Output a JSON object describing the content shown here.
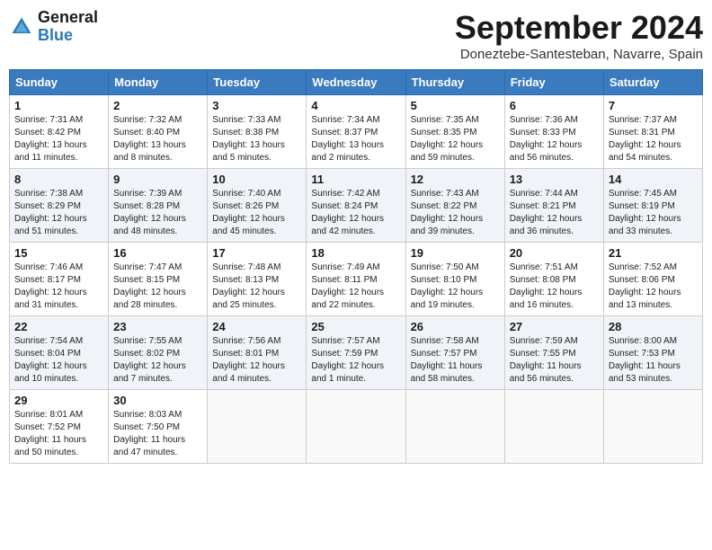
{
  "logo": {
    "line1": "General",
    "line2": "Blue"
  },
  "title": "September 2024",
  "location": "Doneztebe-Santesteban, Navarre, Spain",
  "days_header": [
    "Sunday",
    "Monday",
    "Tuesday",
    "Wednesday",
    "Thursday",
    "Friday",
    "Saturday"
  ],
  "weeks": [
    [
      {
        "day": "1",
        "sunrise": "7:31 AM",
        "sunset": "8:42 PM",
        "daylight": "13 hours and 11 minutes."
      },
      {
        "day": "2",
        "sunrise": "7:32 AM",
        "sunset": "8:40 PM",
        "daylight": "13 hours and 8 minutes."
      },
      {
        "day": "3",
        "sunrise": "7:33 AM",
        "sunset": "8:38 PM",
        "daylight": "13 hours and 5 minutes."
      },
      {
        "day": "4",
        "sunrise": "7:34 AM",
        "sunset": "8:37 PM",
        "daylight": "13 hours and 2 minutes."
      },
      {
        "day": "5",
        "sunrise": "7:35 AM",
        "sunset": "8:35 PM",
        "daylight": "12 hours and 59 minutes."
      },
      {
        "day": "6",
        "sunrise": "7:36 AM",
        "sunset": "8:33 PM",
        "daylight": "12 hours and 56 minutes."
      },
      {
        "day": "7",
        "sunrise": "7:37 AM",
        "sunset": "8:31 PM",
        "daylight": "12 hours and 54 minutes."
      }
    ],
    [
      {
        "day": "8",
        "sunrise": "7:38 AM",
        "sunset": "8:29 PM",
        "daylight": "12 hours and 51 minutes."
      },
      {
        "day": "9",
        "sunrise": "7:39 AM",
        "sunset": "8:28 PM",
        "daylight": "12 hours and 48 minutes."
      },
      {
        "day": "10",
        "sunrise": "7:40 AM",
        "sunset": "8:26 PM",
        "daylight": "12 hours and 45 minutes."
      },
      {
        "day": "11",
        "sunrise": "7:42 AM",
        "sunset": "8:24 PM",
        "daylight": "12 hours and 42 minutes."
      },
      {
        "day": "12",
        "sunrise": "7:43 AM",
        "sunset": "8:22 PM",
        "daylight": "12 hours and 39 minutes."
      },
      {
        "day": "13",
        "sunrise": "7:44 AM",
        "sunset": "8:21 PM",
        "daylight": "12 hours and 36 minutes."
      },
      {
        "day": "14",
        "sunrise": "7:45 AM",
        "sunset": "8:19 PM",
        "daylight": "12 hours and 33 minutes."
      }
    ],
    [
      {
        "day": "15",
        "sunrise": "7:46 AM",
        "sunset": "8:17 PM",
        "daylight": "12 hours and 31 minutes."
      },
      {
        "day": "16",
        "sunrise": "7:47 AM",
        "sunset": "8:15 PM",
        "daylight": "12 hours and 28 minutes."
      },
      {
        "day": "17",
        "sunrise": "7:48 AM",
        "sunset": "8:13 PM",
        "daylight": "12 hours and 25 minutes."
      },
      {
        "day": "18",
        "sunrise": "7:49 AM",
        "sunset": "8:11 PM",
        "daylight": "12 hours and 22 minutes."
      },
      {
        "day": "19",
        "sunrise": "7:50 AM",
        "sunset": "8:10 PM",
        "daylight": "12 hours and 19 minutes."
      },
      {
        "day": "20",
        "sunrise": "7:51 AM",
        "sunset": "8:08 PM",
        "daylight": "12 hours and 16 minutes."
      },
      {
        "day": "21",
        "sunrise": "7:52 AM",
        "sunset": "8:06 PM",
        "daylight": "12 hours and 13 minutes."
      }
    ],
    [
      {
        "day": "22",
        "sunrise": "7:54 AM",
        "sunset": "8:04 PM",
        "daylight": "12 hours and 10 minutes."
      },
      {
        "day": "23",
        "sunrise": "7:55 AM",
        "sunset": "8:02 PM",
        "daylight": "12 hours and 7 minutes."
      },
      {
        "day": "24",
        "sunrise": "7:56 AM",
        "sunset": "8:01 PM",
        "daylight": "12 hours and 4 minutes."
      },
      {
        "day": "25",
        "sunrise": "7:57 AM",
        "sunset": "7:59 PM",
        "daylight": "12 hours and 1 minute."
      },
      {
        "day": "26",
        "sunrise": "7:58 AM",
        "sunset": "7:57 PM",
        "daylight": "11 hours and 58 minutes."
      },
      {
        "day": "27",
        "sunrise": "7:59 AM",
        "sunset": "7:55 PM",
        "daylight": "11 hours and 56 minutes."
      },
      {
        "day": "28",
        "sunrise": "8:00 AM",
        "sunset": "7:53 PM",
        "daylight": "11 hours and 53 minutes."
      }
    ],
    [
      {
        "day": "29",
        "sunrise": "8:01 AM",
        "sunset": "7:52 PM",
        "daylight": "11 hours and 50 minutes."
      },
      {
        "day": "30",
        "sunrise": "8:03 AM",
        "sunset": "7:50 PM",
        "daylight": "11 hours and 47 minutes."
      },
      null,
      null,
      null,
      null,
      null
    ]
  ]
}
